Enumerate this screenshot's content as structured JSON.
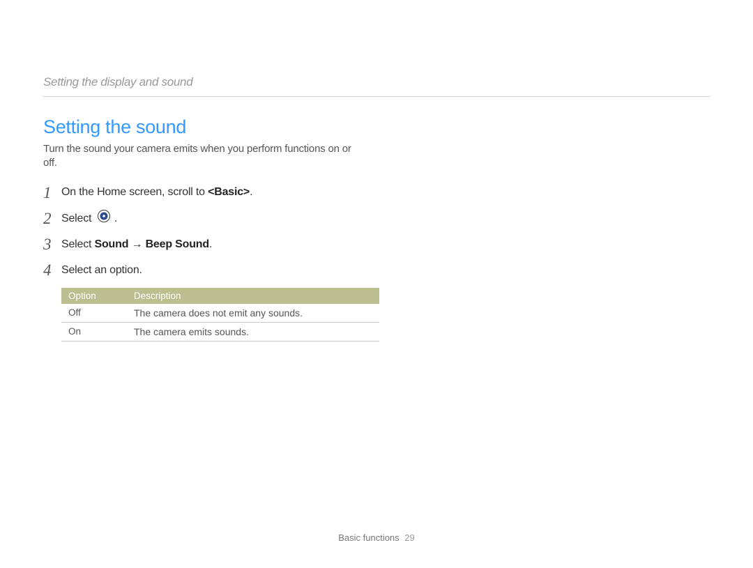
{
  "breadcrumb": "Setting the display and sound",
  "section_title": "Setting the sound",
  "intro_text": "Turn the sound your camera emits when you perform functions on or off.",
  "steps": [
    {
      "num": "1",
      "pre": "On the Home screen, scroll to ",
      "bold": "<Basic>",
      "post": "."
    },
    {
      "num": "2",
      "pre": "Select ",
      "icon": "settings-dial-icon",
      "post": " ."
    },
    {
      "num": "3",
      "pre": "Select ",
      "bold": "Sound → Beep Sound",
      "post": "."
    },
    {
      "num": "4",
      "pre": "Select an option."
    }
  ],
  "table": {
    "headers": [
      "Option",
      "Description"
    ],
    "rows": [
      [
        "Off",
        "The camera does not emit any sounds."
      ],
      [
        "On",
        "The camera emits sounds."
      ]
    ]
  },
  "footer": {
    "section": "Basic functions",
    "page": "29"
  }
}
